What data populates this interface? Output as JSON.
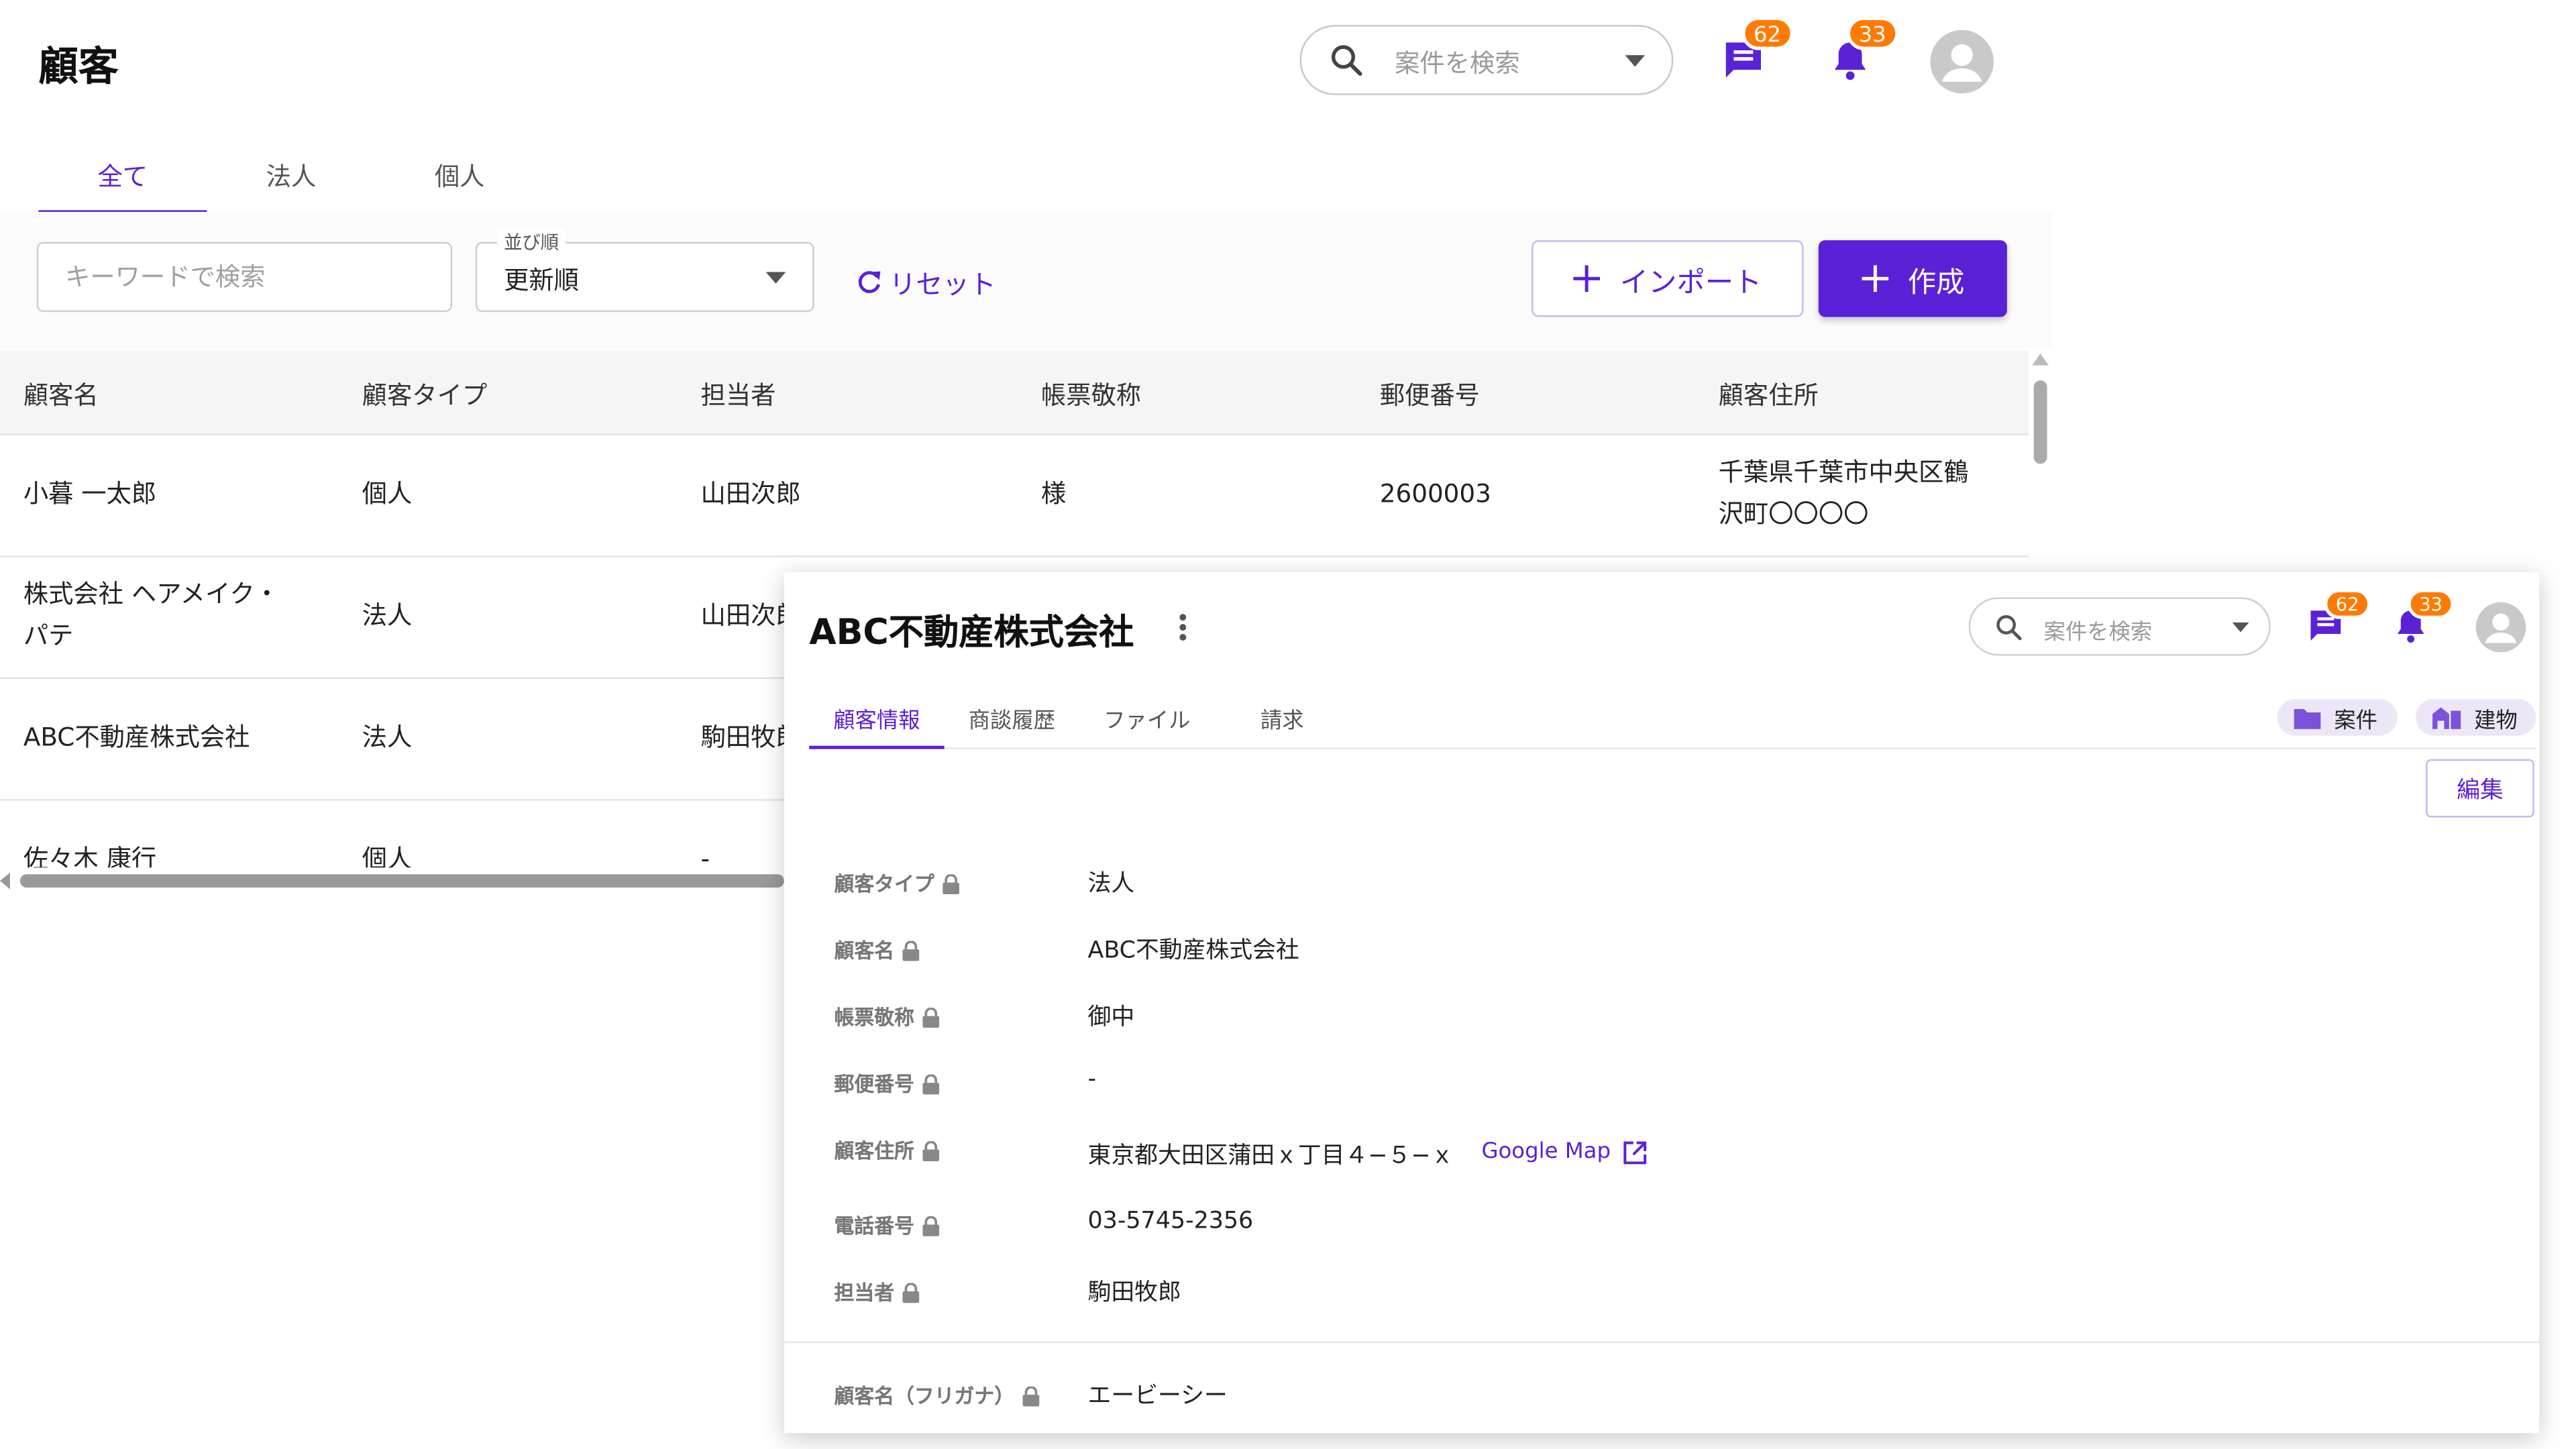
{
  "header": {
    "title": "顧客",
    "search_placeholder": "案件を検索",
    "chat_badge": "62",
    "notif_badge": "33"
  },
  "tabs": [
    {
      "label": "全て",
      "active": true
    },
    {
      "label": "法人",
      "active": false
    },
    {
      "label": "個人",
      "active": false
    }
  ],
  "filters": {
    "keyword_placeholder": "キーワードで検索",
    "sort_label": "並び順",
    "sort_value": "更新順",
    "reset_label": "リセット",
    "import_label": "インポート",
    "create_label": "作成"
  },
  "table": {
    "columns": [
      "顧客名",
      "顧客タイプ",
      "担当者",
      "帳票敬称",
      "郵便番号",
      "顧客住所"
    ],
    "rows": [
      {
        "name": "小暮 一太郎",
        "type": "個人",
        "owner": "山田次郎",
        "honorific": "様",
        "zip": "2600003",
        "address": "千葉県千葉市中央区鶴\n沢町〇〇〇〇"
      },
      {
        "name": "株式会社 ヘアメイク・\nパテ",
        "type": "法人",
        "owner": "山田次郎",
        "honorific": "",
        "zip": "",
        "address": ""
      },
      {
        "name": "ABC不動産株式会社",
        "type": "法人",
        "owner": "駒田牧郎",
        "honorific": "",
        "zip": "",
        "address": ""
      },
      {
        "name": "佐々木 康行",
        "type": "個人",
        "owner": "-",
        "honorific": "",
        "zip": "",
        "address": ""
      }
    ]
  },
  "detail": {
    "title": "ABC不動産株式会社",
    "search_placeholder": "案件を検索",
    "chat_badge": "62",
    "notif_badge": "33",
    "tabs": [
      {
        "label": "顧客情報",
        "active": true
      },
      {
        "label": "商談履歴",
        "active": false
      },
      {
        "label": "ファイル",
        "active": false
      },
      {
        "label": "請求",
        "active": false
      }
    ],
    "chips": {
      "project": "案件",
      "building": "建物"
    },
    "edit_label": "編集",
    "fields": [
      {
        "label": "顧客タイプ",
        "value": "法人"
      },
      {
        "label": "顧客名",
        "value": "ABC不動産株式会社"
      },
      {
        "label": "帳票敬称",
        "value": "御中"
      },
      {
        "label": "郵便番号",
        "value": "-"
      },
      {
        "label": "顧客住所",
        "value": "東京都大田区蒲田ｘ丁目４−５−ｘ"
      },
      {
        "label": "電話番号",
        "value": "03-5745-2356"
      },
      {
        "label": "担当者",
        "value": "駒田牧郎"
      }
    ],
    "map_link": "Google Map",
    "extra_field": {
      "label": "顧客名（フリガナ）",
      "value": "エービーシー"
    }
  },
  "colors": {
    "accent": "#5b21d6",
    "badge": "#ff7a00"
  }
}
